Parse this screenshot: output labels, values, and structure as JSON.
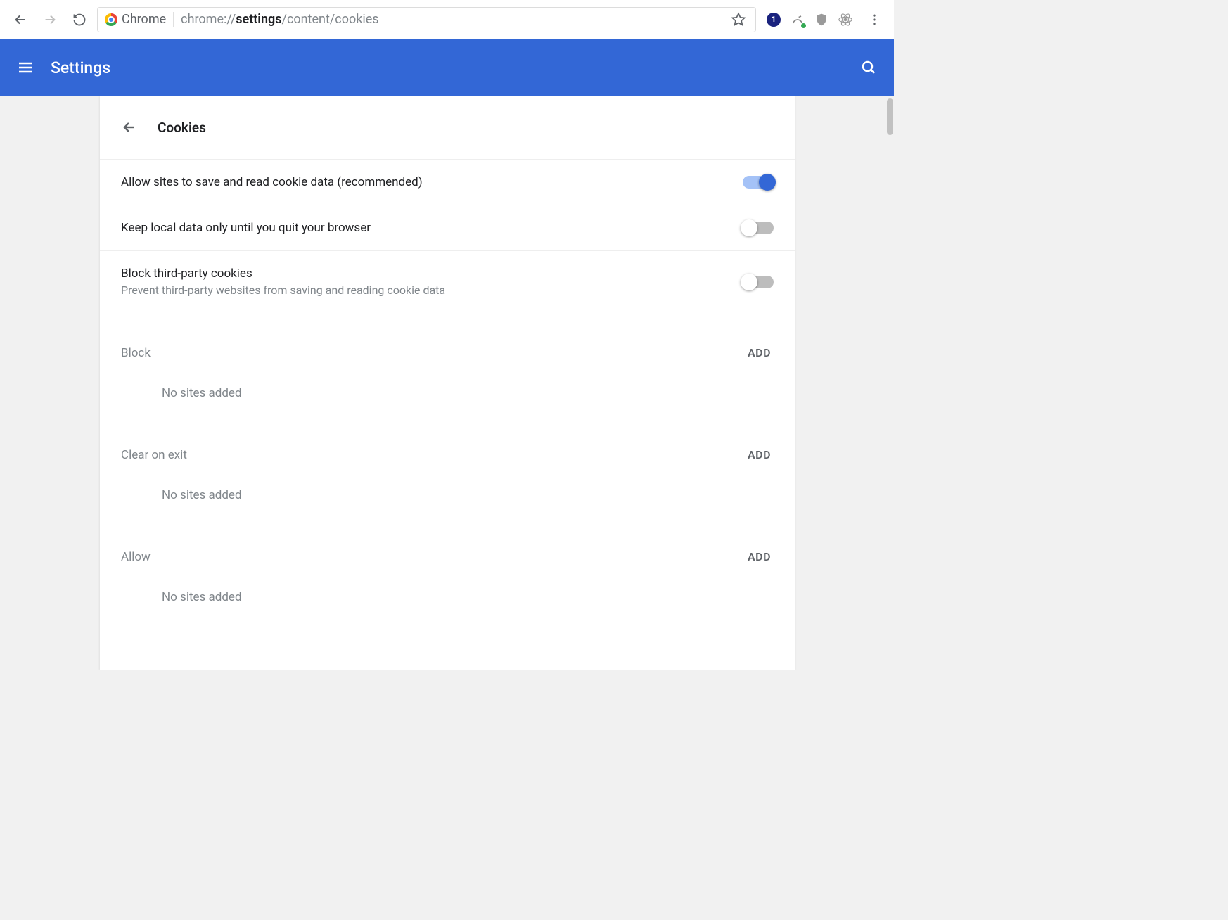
{
  "browser": {
    "url_prefix": "chrome://",
    "url_bold": "settings",
    "url_suffix": "/content/cookies",
    "chrome_label": "Chrome",
    "badge_count": "1"
  },
  "header": {
    "title": "Settings"
  },
  "page": {
    "title": "Cookies",
    "toggles": [
      {
        "label": "Allow sites to save and read cookie data (recommended)",
        "on": true
      },
      {
        "label": "Keep local data only until you quit your browser",
        "on": false
      },
      {
        "label": "Block third-party cookies",
        "desc": "Prevent third-party websites from saving and reading cookie data",
        "on": false
      }
    ],
    "add_label": "ADD",
    "empty_label": "No sites added",
    "sections": [
      {
        "title": "Block"
      },
      {
        "title": "Clear on exit"
      },
      {
        "title": "Allow"
      }
    ]
  }
}
